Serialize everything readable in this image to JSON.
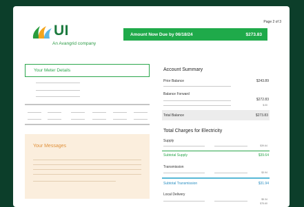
{
  "page": {
    "number": "Page 2 of 3"
  },
  "logo": {
    "text": "UI",
    "subtitle": "An Avangrid company"
  },
  "due": {
    "label": "Amount Now Due by 06/18/24",
    "amount": "$273.83"
  },
  "meter": {
    "title": "Your Meter Details"
  },
  "messages": {
    "title": "Your Messages"
  },
  "account_summary": {
    "title": "Account Summary",
    "prior_balance_label": "Prior Balance",
    "prior_balance_value": "$243.89",
    "balance_forward_label": "Balance Forward",
    "balance_forward_value": "$272.83",
    "balance_forward_sub": "$.00",
    "total_label": "Total Balance",
    "total_value": "$273.83"
  },
  "charges": {
    "title": "Total Charges for Electricity",
    "supply_label": "Supply",
    "supply_line_value": "$39.64",
    "subtotal_supply_label": "Subtotal Supply",
    "subtotal_supply_value": "$39.64",
    "transmission_label": "Transmission",
    "transmission_line_value": "$3.94",
    "subtotal_transmission_label": "Subtotal Transmission",
    "subtotal_transmission_value": "$31.94",
    "local_delivery_label": "Local Delivery",
    "local_delivery_value_1": "$5.34",
    "local_delivery_value_2": "$75.60"
  },
  "colors": {
    "background": "#0c3e2a",
    "green": "#1faa4a",
    "blue": "#2b8fc2",
    "message_bg": "#fbeedd"
  }
}
